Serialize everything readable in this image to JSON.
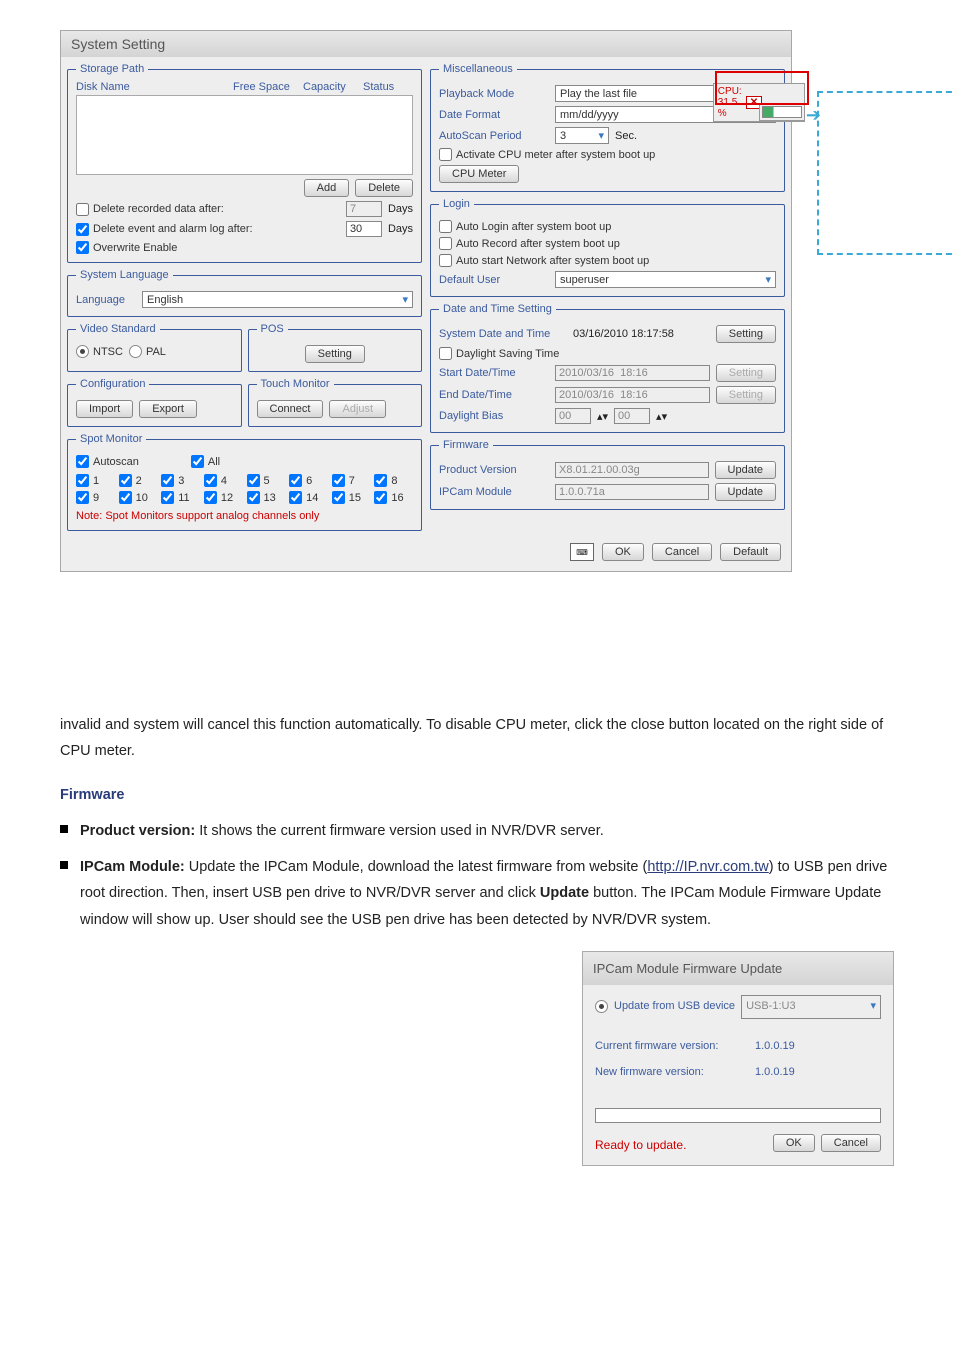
{
  "win": {
    "title": "System Setting"
  },
  "storage": {
    "legend": "Storage Path",
    "cols": {
      "a": "Disk Name",
      "b": "Free Space",
      "c": "Capacity",
      "d": "Status"
    },
    "add": "Add",
    "del": "Delete",
    "delrec": "Delete recorded data after:",
    "delrec_v": "7",
    "delrec_u": "Days",
    "delevt": "Delete event and alarm log after:",
    "delevt_v": "30",
    "delevt_u": "Days",
    "ow": "Overwrite Enable"
  },
  "lang": {
    "legend": "System Language",
    "lbl": "Language",
    "val": "English"
  },
  "vstd": {
    "legend": "Video Standard",
    "ntsc": "NTSC",
    "pal": "PAL"
  },
  "pos": {
    "legend": "POS",
    "btn": "Setting"
  },
  "cfg": {
    "legend": "Configuration",
    "imp": "Import",
    "exp": "Export"
  },
  "touch": {
    "legend": "Touch Monitor",
    "con": "Connect",
    "adj": "Adjust"
  },
  "spot": {
    "legend": "Spot Monitor",
    "auto": "Autoscan",
    "all": "All",
    "note": "Note: Spot Monitors support analog channels only",
    "ch": [
      "1",
      "2",
      "3",
      "4",
      "5",
      "6",
      "7",
      "8",
      "9",
      "10",
      "11",
      "12",
      "13",
      "14",
      "15",
      "16"
    ]
  },
  "misc": {
    "legend": "Miscellaneous",
    "pb": "Playback Mode",
    "pb_v": "Play the last file",
    "df": "Date Format",
    "df_v": "mm/dd/yyyy",
    "as": "AutoScan Period",
    "as_v": "3",
    "as_u": "Sec.",
    "actcpu": "Activate CPU meter after system boot up",
    "cpu": "CPU Meter",
    "cpuw": "CPU: 31.5 %"
  },
  "login": {
    "legend": "Login",
    "a": "Auto Login after system boot up",
    "b": "Auto Record after system boot up",
    "c": "Auto start Network after system boot up",
    "du": "Default User",
    "du_v": "superuser"
  },
  "dt": {
    "legend": "Date and Time Setting",
    "sdt": "System Date and Time",
    "sdt_v": "03/16/2010  18:17:58",
    "set": "Setting",
    "dst": "Daylight Saving Time",
    "sd": "Start Date/Time",
    "sd_v": "2010/03/16  18:16",
    "ed": "End Date/Time",
    "ed_v": "2010/03/16  18:16",
    "db": "Daylight Bias",
    "b1": "00",
    "b2": "00"
  },
  "fw": {
    "legend": "Firmware",
    "pv": "Product Version",
    "pv_v": "X8.01.21.00.03g",
    "ip": "IPCam Module",
    "ip_v": "1.0.0.71a",
    "upd": "Update"
  },
  "bar": {
    "ok": "OK",
    "cancel": "Cancel",
    "def": "Default"
  },
  "doc": {
    "p1": "invalid and system will cancel this function automatically. To disable CPU meter, click the close button located on the right side of CPU meter.",
    "sub": "Firmware",
    "pv": "Product version: It shows the current firmware version used in NVR/DVR server.",
    "ip": "IPCam Module: Update the IPCam Module, download the latest firmware from website () to USB pen drive root direction. Then, insert USB pen drive to NVR/DVR server and click Update button. The IPCam Module Firmware Update window will show up. User should see the USB pen drive has been detected by NVR/DVR system.",
    "url": "http://IP.nvr.com.tw"
  },
  "ipwin": {
    "title": "IPCam Module Firmware Update",
    "usb": "Update from USB device",
    "usb_v": "USB-1:U3",
    "cur": "Current firmware version:",
    "cur_v": "1.0.0.19",
    "new": "New firmware version:",
    "new_v": "1.0.0.19",
    "ready": "Ready to update.",
    "ok": "OK",
    "cancel": "Cancel"
  }
}
